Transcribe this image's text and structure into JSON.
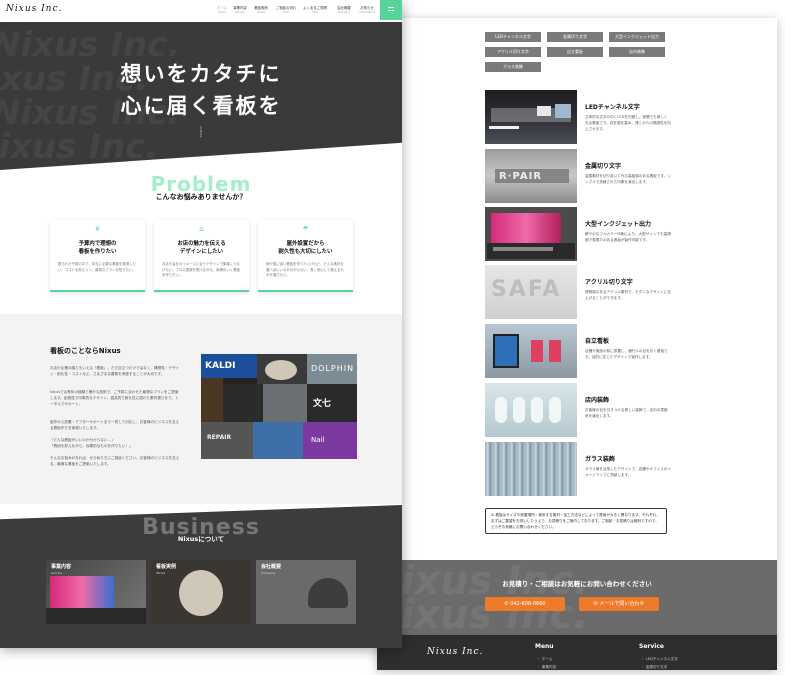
{
  "brand": {
    "logo": "Nixus Inc.",
    "accent": "#55d59a",
    "orange": "#ef7b2a"
  },
  "header": {
    "nav": [
      {
        "label": "ホーム",
        "sub": "home"
      },
      {
        "label": "事業内容",
        "sub": "Service"
      },
      {
        "label": "看板実例",
        "sub": "Works"
      },
      {
        "label": "ご相談の流れ",
        "sub": "Flow"
      },
      {
        "label": "よくあるご質問",
        "sub": "FAQ"
      },
      {
        "label": "会社概要",
        "sub": "Company"
      },
      {
        "label": "お知らせ",
        "sub": "Information"
      }
    ]
  },
  "hero": {
    "line1": "想いをカタチに",
    "line2": "心に届く看板を",
    "scroll": "SCROLL",
    "bg_word": "Nixus Inc."
  },
  "problem": {
    "bg_word": "Problem",
    "heading": "こんなお悩みありませんか？",
    "cards": [
      {
        "icon": "¥",
        "title": "予算内で理想の\n看板を作りたい",
        "desc": "限られた予算の中で、本当に必要な看板を実現したい。コストを抑えつつ、最適なプランを知りたい。"
      },
      {
        "icon": "⌂",
        "title": "お店の魅力を伝える\nデザインにしたい",
        "desc": "お店や会社のイメージに合うデザインで集客につなげたい。プロの提案を受けながら、納得のいく看板を作りたい。"
      },
      {
        "icon": "☂",
        "title": "屋外設置だから\n耐久性も大切にしたい",
        "desc": "雨や風に強い看板を作りたいけれど、どんな素材を選べばいいのか分からない。長く安心して使えるものを選びたい。"
      }
    ]
  },
  "about": {
    "title": "看板のことならNixus",
    "paragraphs": [
      "お店や企業の顔ともいえる「看板」。ただ目立つだけではなく、構想性・デザイン・耐久性・コストなど、さまざまな要素を考慮することが大切です。",
      "Nixusでは長年の経験と確かな技術で、ご予算に合わせた最適なプランをご提案します。創造性で印象的なデザイン、高品質で耐久性に優れた素材選びまで、トータルでサポート。",
      "製作から設置・アフターサポートまで一貫して対応し、お客様のビジネスを支える看板作りを実現いたします。",
      "「どんな看板がいいのか分からない…」\n「費用を抑えながら、効果的なものを作りたい！」",
      "そんなお悩みがあれば、ぜひ私たちにご相談ください。お客様のビジネスを支える、最適な看板をご提案いたします。"
    ],
    "collage_labels": [
      "KALDI",
      "DOLPHIN",
      "REPAIR",
      "文七",
      "Nail"
    ]
  },
  "business": {
    "bg_word": "Business",
    "heading": "Nixusについて",
    "cards": [
      {
        "title": "事業内容",
        "sub": "Service"
      },
      {
        "title": "看板実例",
        "sub": "Works"
      },
      {
        "title": "会社概要",
        "sub": "Company"
      }
    ]
  },
  "right": {
    "tags": [
      "LEDチャンネル文字",
      "金属切り文字",
      "大型インクジェット出力",
      "アクリル切り文字",
      "自立看板",
      "店内装飾",
      "ガラス装飾"
    ],
    "services": [
      {
        "title": "LEDチャンネル文字",
        "desc": "立体的な文字の中にLEDを内蔵し、夜間でも美しく光る看板です。存在感を高め、遠くからの視認性を向上させます。"
      },
      {
        "title": "金属切り文字",
        "desc": "金属素材を切り抜いて作る高級感のある看板です。シンプルで洗練された印象を演出します。"
      },
      {
        "title": "大型インクジェット出力",
        "desc": "鮮やかなフルカラー印刷により、大型サインでも高精細で表現力のある看板が製作可能です。"
      },
      {
        "title": "アクリル切り文字",
        "desc": "透明感のあるアクリル素材で、モダンなデザインに仕上げることができます。"
      },
      {
        "title": "自立看板",
        "desc": "店舗や施設の前に設置し、通行人の目を引く看板です。目的に応じたデザインで製作します。"
      },
      {
        "title": "店内装飾",
        "desc": "お客様の目を引きつける美しい装飾で、店内の雰囲気を演出します。"
      },
      {
        "title": "ガラス装飾",
        "desc": "ガラス面を活用したデザインで、店舗やオフィスのイメージアップに貢献します。"
      }
    ],
    "note": "☑ 看板はサイズや設置場所・使用する素材・加工方法などによって費用が大きく異なります。それぞれ、まずはご要望をお伺いしたうえで、お見積りをご案内しております。ご相談・お見積りは無料ですので、どうぞお気軽にお問い合わせください。",
    "contact": {
      "title": "お見積り・ご相談はお気軽にお問い合わせください",
      "phone": "✆ 042-808-0660",
      "mail": "✉ メールで問い合わせ",
      "bg_word": "Nixus Inc."
    },
    "footer": {
      "logo": "Nixus Inc.",
      "menu_title": "Menu",
      "menu": [
        "ホーム",
        "事業内容"
      ],
      "service_title": "Service",
      "service": [
        "LEDチャンネル文字",
        "金属切り文字"
      ]
    }
  }
}
